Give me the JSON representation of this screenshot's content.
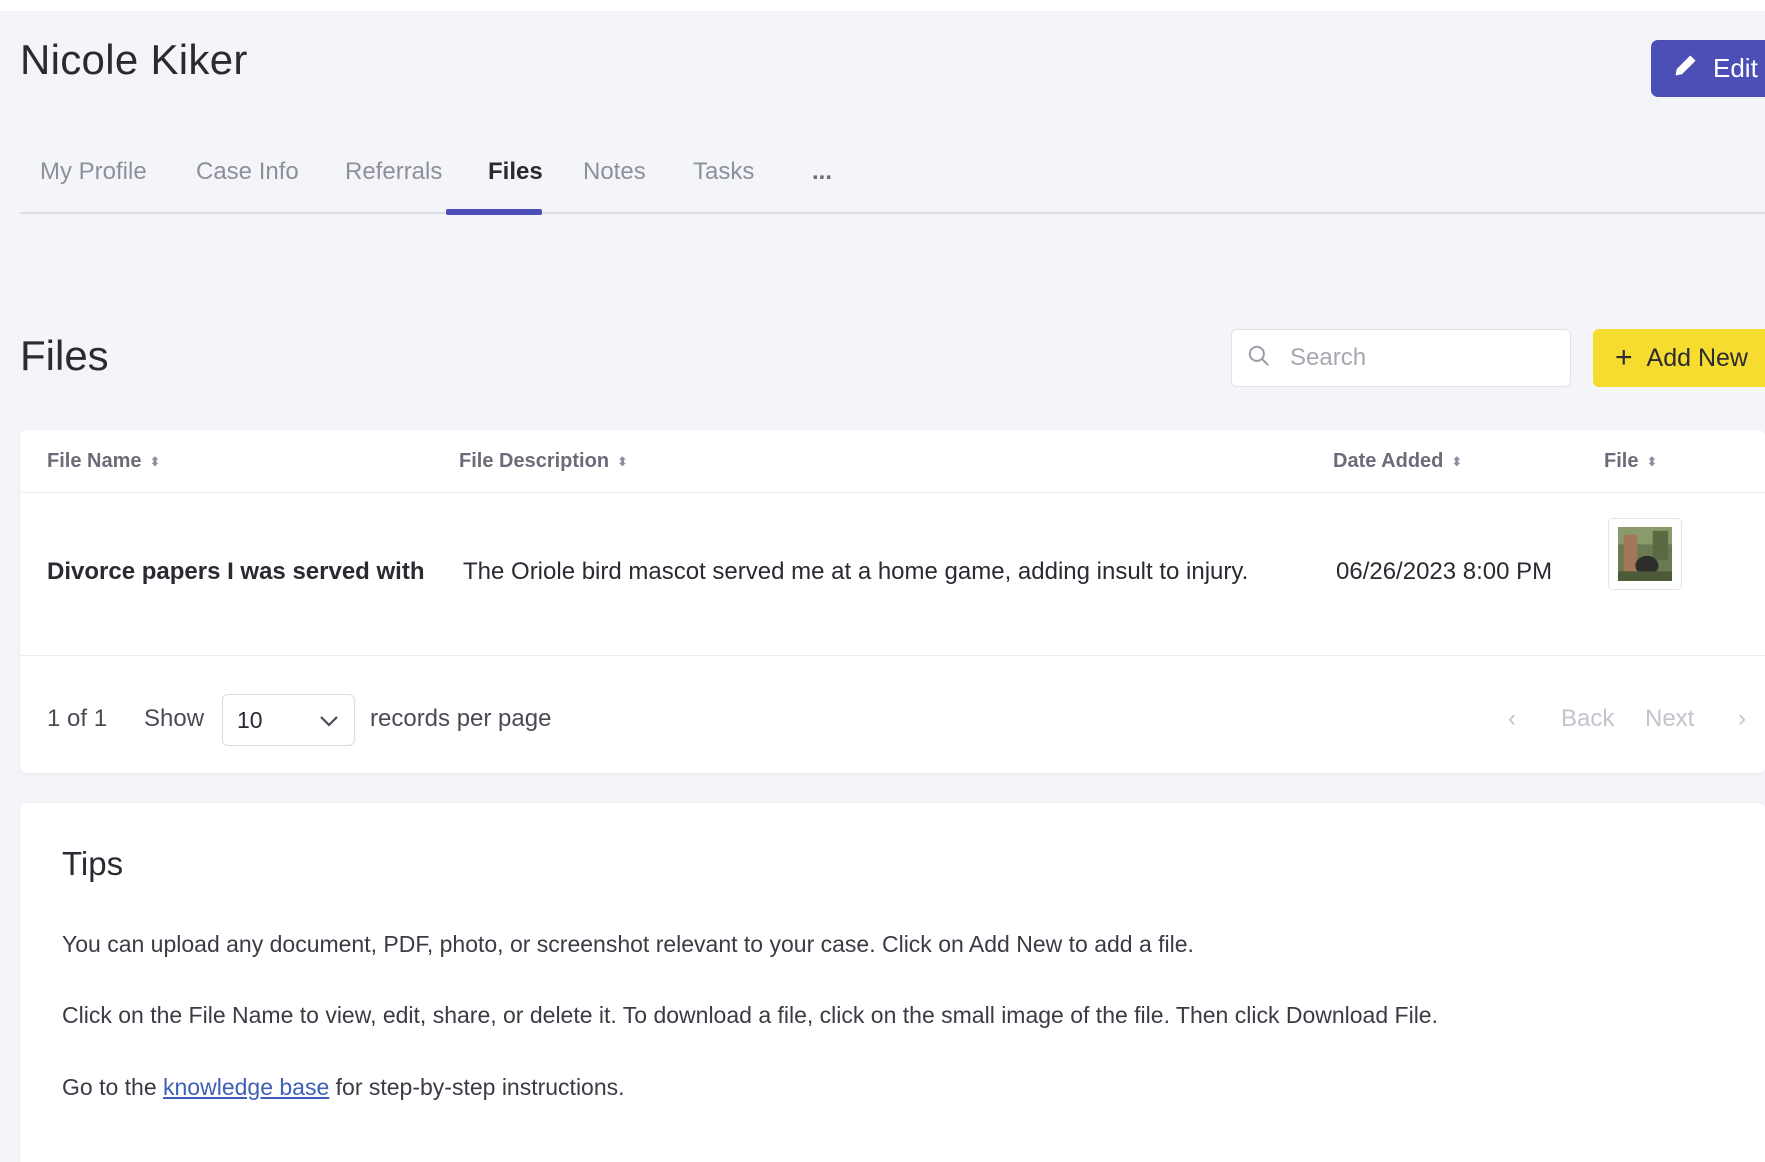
{
  "header": {
    "person_name": "Nicole Kiker",
    "edit_label": "Edit",
    "accent_color": "#4b4fb6"
  },
  "tabs": [
    {
      "label": "My Profile",
      "active": false
    },
    {
      "label": "Case Info",
      "active": false
    },
    {
      "label": "Referrals",
      "active": false
    },
    {
      "label": "Files",
      "active": true
    },
    {
      "label": "Notes",
      "active": false
    },
    {
      "label": "Tasks",
      "active": false
    },
    {
      "label": "...",
      "active": false
    }
  ],
  "files_section": {
    "title": "Files",
    "search_placeholder": "Search",
    "search_value": "",
    "add_new_label": "Add New",
    "add_new_color": "#f5dc2e"
  },
  "table": {
    "columns": [
      "File Name",
      "File Description",
      "Date Added",
      "File"
    ],
    "rows": [
      {
        "file_name": "Divorce papers I was served with",
        "file_description": "The Oriole bird mascot served me at a home game, adding insult to injury.",
        "date_added": "06/26/2023 8:00 PM",
        "file_icon": "photo-thumbnail"
      }
    ]
  },
  "pagination": {
    "page_info": "1 of 1",
    "show_label": "Show",
    "page_size": "10",
    "per_page_label": "records per page",
    "back_label": "Back",
    "next_label": "Next"
  },
  "tips": {
    "title": "Tips",
    "line1": "You can upload any document, PDF, photo, or screenshot relevant to your case. Click on Add New to add a file.",
    "line2": "Click on the File Name to view, edit, share, or delete it. To download a file, click on the small image of the file. Then click Download File.",
    "line3_before": "Go to the ",
    "line3_link": "knowledge base",
    "line3_after": " for step-by-step instructions."
  }
}
